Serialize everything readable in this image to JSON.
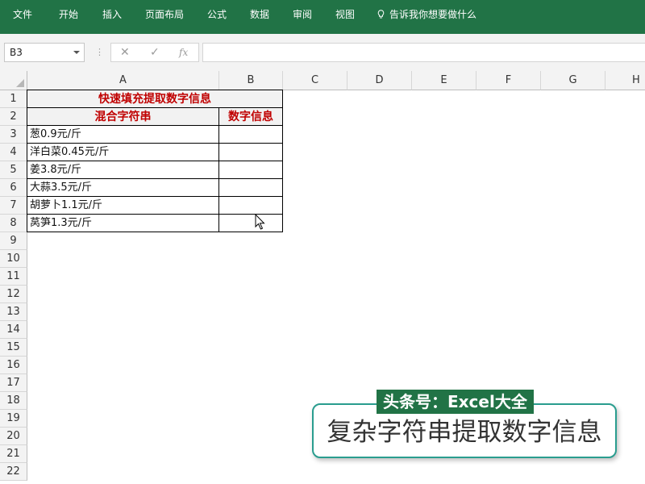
{
  "ribbon": {
    "tabs": [
      "文件",
      "开始",
      "插入",
      "页面布局",
      "公式",
      "数据",
      "审阅",
      "视图"
    ],
    "tell_me": "告诉我你想要做什么",
    "color": "#217346"
  },
  "formula_bar": {
    "name_box": "B3",
    "cancel_icon": "✕",
    "enter_icon": "✓",
    "fx_icon": "fx",
    "formula": ""
  },
  "sheet": {
    "columns": [
      "A",
      "B",
      "C",
      "D",
      "E",
      "F",
      "G",
      "H"
    ],
    "rows": [
      "1",
      "2",
      "3",
      "4",
      "5",
      "6",
      "7",
      "8",
      "9",
      "10",
      "11",
      "12",
      "13",
      "14",
      "15",
      "16",
      "17",
      "18",
      "19",
      "20",
      "21",
      "22"
    ],
    "title": "快速填充提取数字信息",
    "header_a": "混合字符串",
    "header_b": "数字信息",
    "data": [
      {
        "a": "葱0.9元/斤",
        "b": ""
      },
      {
        "a": "洋白菜0.45元/斤",
        "b": ""
      },
      {
        "a": "姜3.8元/斤",
        "b": ""
      },
      {
        "a": "大蒜3.5元/斤",
        "b": ""
      },
      {
        "a": "胡萝卜1.1元/斤",
        "b": ""
      },
      {
        "a": "莴笋1.3元/斤",
        "b": ""
      }
    ],
    "header_text_color": "#c00000",
    "selected_cell": "B3"
  },
  "watermark": {
    "label": "头条号：Excel大全",
    "text": "复杂字符串提取数字信息"
  }
}
